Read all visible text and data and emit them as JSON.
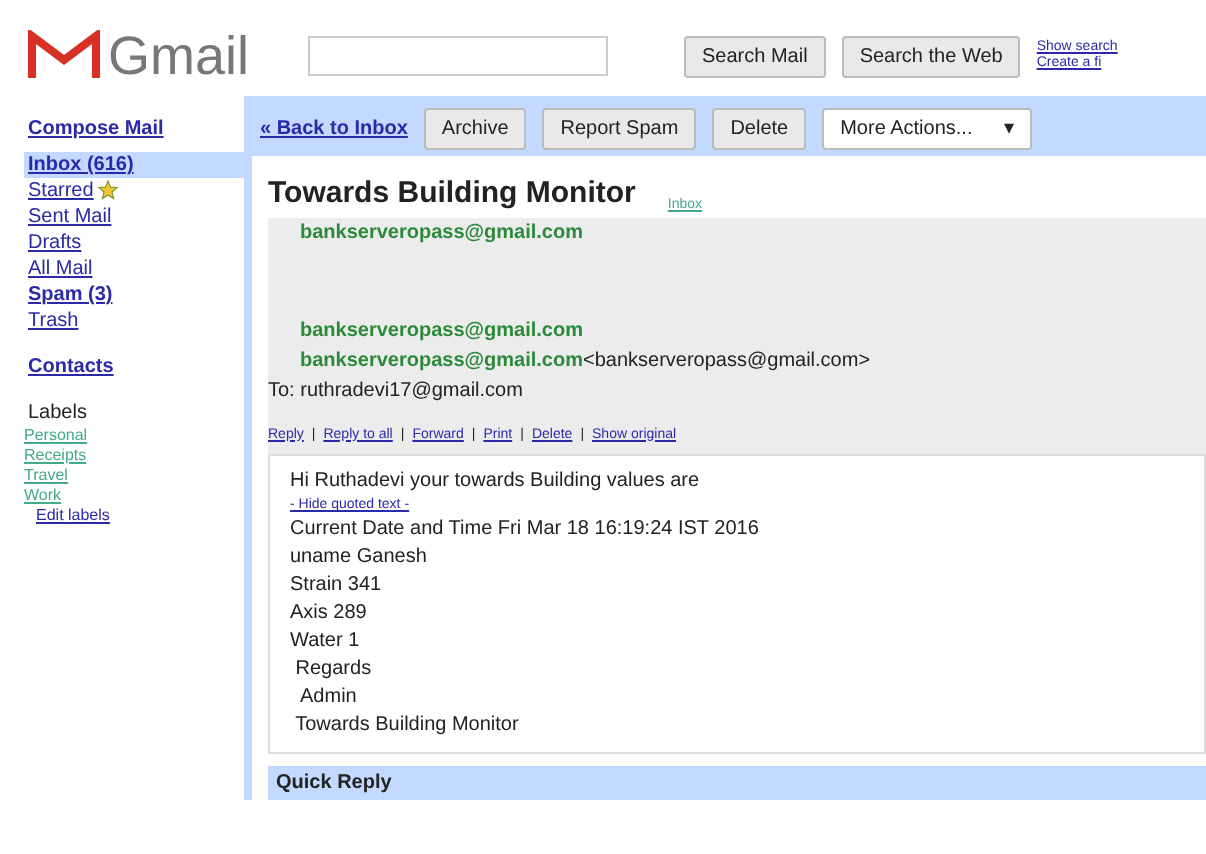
{
  "logo": {
    "text": "Gmail"
  },
  "search": {
    "buttons": [
      "Search Mail",
      "Search the Web"
    ],
    "links": [
      "Show search",
      "Create a fi"
    ]
  },
  "sidebar": {
    "compose": "Compose Mail",
    "items": [
      {
        "label": "Inbox (616)",
        "bold": true,
        "selected": true,
        "starred": false
      },
      {
        "label": "Starred",
        "bold": false,
        "selected": false,
        "starred": true
      },
      {
        "label": "Sent Mail",
        "bold": false,
        "selected": false,
        "starred": false
      },
      {
        "label": "Drafts",
        "bold": false,
        "selected": false,
        "starred": false
      },
      {
        "label": "All Mail",
        "bold": false,
        "selected": false,
        "starred": false
      },
      {
        "label": "Spam (3)",
        "bold": true,
        "selected": false,
        "starred": false
      },
      {
        "label": "Trash",
        "bold": false,
        "selected": false,
        "starred": false
      }
    ],
    "contacts": "Contacts",
    "labels_heading": "Labels",
    "labels": [
      "Personal",
      "Receipts",
      "Travel",
      "Work"
    ],
    "edit_labels": "Edit labels"
  },
  "toolbar": {
    "back": "« Back to Inbox",
    "buttons": [
      "Archive",
      "Report Spam",
      "Delete"
    ],
    "more": "More Actions...",
    "more_caret": "▾"
  },
  "message": {
    "subject": "Towards Building Monitor",
    "tag": "Inbox",
    "senders": [
      {
        "name": "bankserveropass@gmail.com",
        "collapsed": true
      },
      {
        "name": "bankserveropass@gmail.com",
        "collapsed": false
      }
    ],
    "from": "bankserveropass@gmail.com",
    "from_address": "<bankserveropass@gmail.com>",
    "to": "To: ruthradevi17@gmail.com",
    "action_separator": "|",
    "actions": [
      "Reply",
      "Reply to all",
      "Forward",
      "Print",
      "Delete",
      "Show original"
    ],
    "greeting": "Hi Ruthadevi your towards  Building values are",
    "hide_quoted": "- Hide quoted text -",
    "lines": [
      "Current Date and Time Fri Mar 18 16:19:24 IST 2016",
      "uname Ganesh",
      "Strain 341",
      "Axis 289",
      "Water 1",
      " Regards",
      "  Admin",
      " Towards Building Monitor"
    ]
  },
  "quick_reply": "Quick Reply"
}
